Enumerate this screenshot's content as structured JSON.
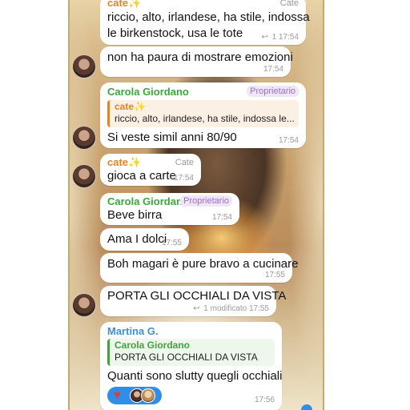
{
  "messages": [
    {
      "sender": "cate✨",
      "role": "Cate",
      "lines": [
        "riccio, alto, irlandese, ha stile, indossa",
        "le birkenstock, usa le tote"
      ],
      "replies": "1",
      "time": "17:54"
    },
    {
      "text": "non ha paura di mostrare emozioni",
      "time": "17:54"
    },
    {
      "sender": "Carola Giordano",
      "role": "Proprietario",
      "quote": {
        "name": "cate✨",
        "text": "riccio, alto, irlandese, ha stile, indossa le..."
      },
      "text": "Si veste simil anni 80/90",
      "time": "17:54"
    },
    {
      "sender": "cate✨",
      "role": "Cate",
      "text": "gioca a carte",
      "time": "17:54"
    },
    {
      "sender": "Carola Giordano",
      "role": "Proprietario",
      "text": "Beve birra",
      "time": "17:54"
    },
    {
      "text": "Ama I dolci",
      "time": "17:55"
    },
    {
      "text": "Boh magari è pure bravo a cucinare",
      "time": "17:55"
    },
    {
      "text": "PORTA GLI OCCHIALI DA VISTA",
      "replies": "1",
      "edited": "modificato",
      "time": "17:55"
    },
    {
      "sender": "Martina G.",
      "quote": {
        "name": "Carola Giordano",
        "text": "PORTA GLI OCCHIALI DA VISTA"
      },
      "text": "Quanti sono slutty quegli occhiali",
      "reactions": [
        "heart-icon",
        "reactor-avatar"
      ],
      "time": "17:56"
    }
  ],
  "colors": {
    "cate": "#e0851f",
    "carola": "#3fa43f",
    "martina": "#3f8fd1",
    "reaction_pill": "#2f8ee8"
  }
}
